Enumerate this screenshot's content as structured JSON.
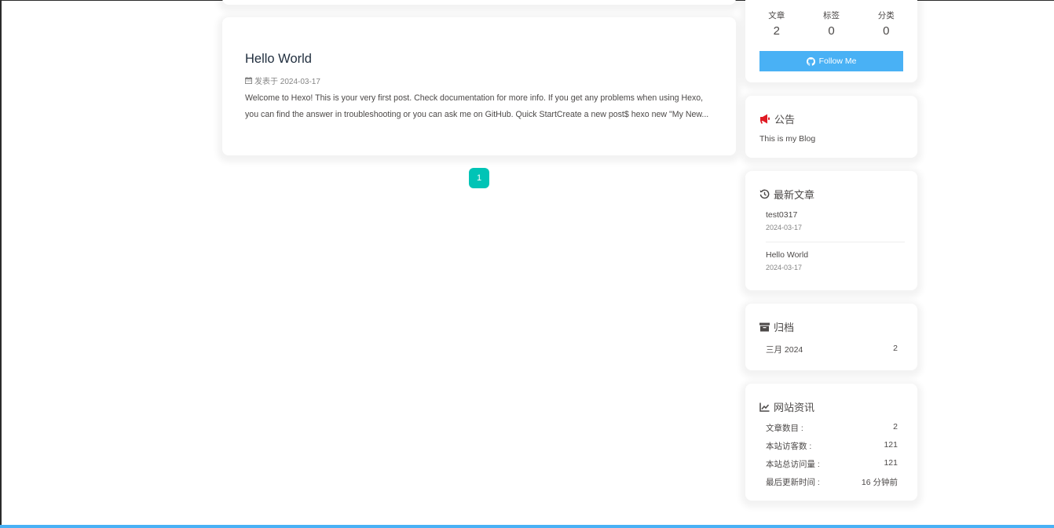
{
  "post": {
    "title": "Hello World",
    "meta": "发表于 2024-03-17",
    "excerpt": "Welcome to Hexo! This is your very first post. Check documentation for more info. If you get any problems when using Hexo, you can find the answer in troubleshooting or you can ask me on GitHub. Quick StartCreate a new post$ hexo new \"My New..."
  },
  "pagination": {
    "current": "1"
  },
  "author": {
    "stats": [
      {
        "label": "文章",
        "value": "2"
      },
      {
        "label": "标签",
        "value": "0"
      },
      {
        "label": "分类",
        "value": "0"
      }
    ],
    "follow_label": "Follow Me"
  },
  "notice": {
    "title": "公告",
    "text": "This is my Blog"
  },
  "recent": {
    "title": "最新文章",
    "items": [
      {
        "title": "test0317",
        "date": "2024-03-17"
      },
      {
        "title": "Hello World",
        "date": "2024-03-17"
      }
    ]
  },
  "archive": {
    "title": "归档",
    "items": [
      {
        "label": "三月 2024",
        "count": "2"
      }
    ]
  },
  "webinfo": {
    "title": "网站资讯",
    "rows": [
      {
        "label": "文章数目 :",
        "value": "2"
      },
      {
        "label": "本站访客数 :",
        "value": "121"
      },
      {
        "label": "本站总访问量 :",
        "value": "121"
      },
      {
        "label": "最后更新时间 :",
        "value": "16 分钟前"
      }
    ]
  },
  "colors": {
    "accent": "#49b1f5",
    "pager": "#00c4b6",
    "notice_icon": "#e01b24"
  },
  "icons": [
    "calendar-icon",
    "github-icon",
    "bullhorn-icon",
    "history-icon",
    "archive-icon",
    "chart-line-icon"
  ]
}
